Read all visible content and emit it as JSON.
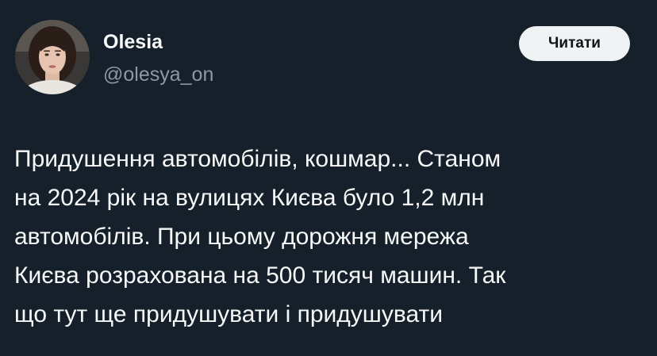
{
  "author": {
    "name": "Olesia",
    "handle": "@olesya_on"
  },
  "follow_button": {
    "label": "Читати"
  },
  "tweet": {
    "lines": [
      "Придушення автомобілів, кошмар... Станом",
      "на 2024 рік на вулицях Києва було 1,2 млн",
      "автомобілів. При цьому дорожня мережа",
      "Києва розрахована на 500 тисяч машин. Так",
      "що тут ще придушувати і придушувати"
    ]
  },
  "colors": {
    "background": "#15202b",
    "text_primary": "#f7f9f9",
    "text_secondary": "#8b98a5",
    "button_background": "#eff3f4",
    "button_text": "#0f1419"
  }
}
